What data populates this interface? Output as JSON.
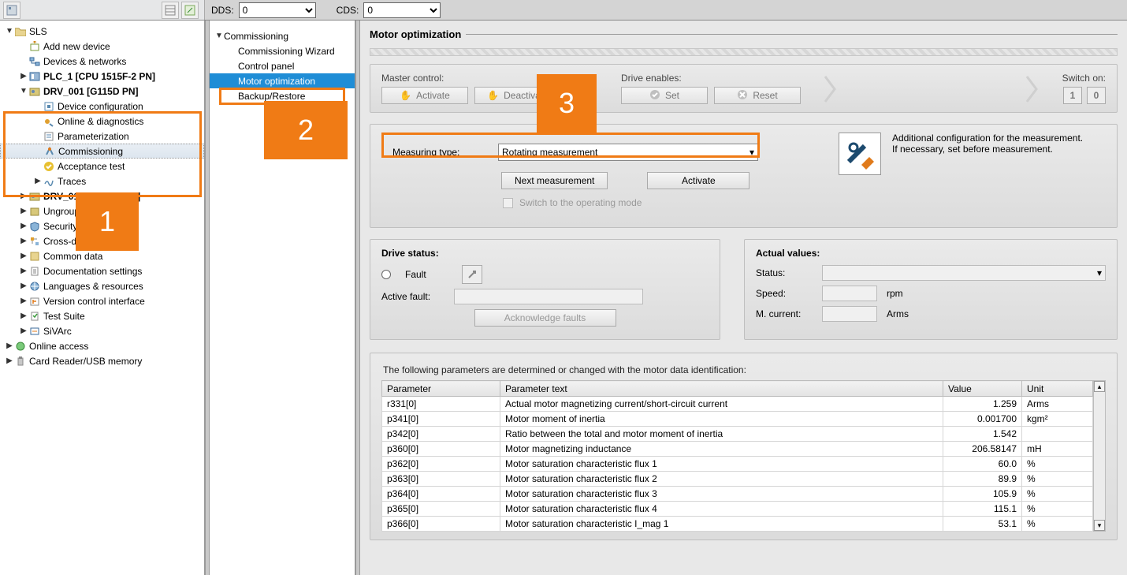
{
  "top": {
    "dds_label": "DDS:",
    "dds_value": "0",
    "cds_label": "CDS:",
    "cds_value": "0"
  },
  "tree": {
    "root": "SLS",
    "items": [
      {
        "label": "Add new device",
        "indent": 1,
        "icon": "add-device"
      },
      {
        "label": "Devices & networks",
        "indent": 1,
        "icon": "net"
      },
      {
        "label": "PLC_1 [CPU 1515F-2 PN]",
        "indent": 1,
        "icon": "plc",
        "exp": "▶",
        "bold": true
      },
      {
        "label": "DRV_001 [G115D PN]",
        "indent": 1,
        "icon": "drive",
        "exp": "▼",
        "bold": true,
        "boxed": true
      },
      {
        "label": "Device configuration",
        "indent": 2,
        "icon": "dev-cfg"
      },
      {
        "label": "Online & diagnostics",
        "indent": 2,
        "icon": "diag"
      },
      {
        "label": "Parameterization",
        "indent": 2,
        "icon": "param"
      },
      {
        "label": "Commissioning",
        "indent": 2,
        "icon": "commission",
        "selected": true
      },
      {
        "label": "Acceptance test",
        "indent": 2,
        "icon": "accept",
        "covered": true
      },
      {
        "label": "Traces",
        "indent": 2,
        "icon": "trace",
        "exp": "▶",
        "covered": true
      },
      {
        "label": "DRV_01          240D-2 PN-F]",
        "indent": 1,
        "icon": "drive",
        "exp": "▶",
        "bold": true,
        "covered": true
      },
      {
        "label": "Ungrouped devices",
        "indent": 1,
        "icon": "ungroup",
        "exp": "▶",
        "covered": true
      },
      {
        "label": "Security settings",
        "indent": 1,
        "icon": "shield",
        "exp": "▶"
      },
      {
        "label": "Cross-device functions",
        "indent": 1,
        "icon": "cross",
        "exp": "▶"
      },
      {
        "label": "Common data",
        "indent": 1,
        "icon": "common",
        "exp": "▶"
      },
      {
        "label": "Documentation settings",
        "indent": 1,
        "icon": "doc",
        "exp": "▶"
      },
      {
        "label": "Languages & resources",
        "indent": 1,
        "icon": "lang",
        "exp": "▶"
      },
      {
        "label": "Version control interface",
        "indent": 1,
        "icon": "vcs",
        "exp": "▶"
      },
      {
        "label": "Test Suite",
        "indent": 1,
        "icon": "test",
        "exp": "▶"
      },
      {
        "label": "SiVArc",
        "indent": 1,
        "icon": "siv",
        "exp": "▶"
      }
    ],
    "bottom": [
      {
        "label": "Online access",
        "icon": "online",
        "exp": "▶"
      },
      {
        "label": "Card Reader/USB memory",
        "icon": "usb",
        "exp": "▶"
      }
    ]
  },
  "sec_tree": {
    "root": "Commissioning",
    "items": [
      {
        "label": "Commissioning Wizard"
      },
      {
        "label": "Control panel"
      },
      {
        "label": "Motor optimization",
        "selected": true,
        "boxed": true
      },
      {
        "label": "Backup/Restore",
        "covered": true
      }
    ]
  },
  "content": {
    "title": "Motor optimization",
    "master": {
      "label": "Master control:",
      "activate": "Activate",
      "deactivate": "Deactivate"
    },
    "drive_enables": {
      "label": "Drive enables:",
      "set": "Set",
      "reset": "Reset"
    },
    "switch_on": {
      "label": "Switch on:",
      "b1": "1",
      "b0": "0"
    },
    "measuring": {
      "label": "Measuring type:",
      "value": "Rotating measurement",
      "next": "Next measurement",
      "activate": "Activate",
      "switch_op": "Switch to the operating mode"
    },
    "config_note_1": "Additional configuration for the measurement.",
    "config_note_2": "If necessary, set before measurement.",
    "drive_status": {
      "title": "Drive status:",
      "fault": "Fault",
      "active_fault": "Active fault:",
      "ack": "Acknowledge faults"
    },
    "actual": {
      "title": "Actual values:",
      "status": "Status:",
      "speed": "Speed:",
      "speed_unit": "rpm",
      "mcurrent": "M. current:",
      "mcurrent_unit": "Arms"
    },
    "table_caption": "The following parameters are determined or changed with the motor data identification:",
    "columns": {
      "p": "Parameter",
      "t": "Parameter text",
      "v": "Value",
      "u": "Unit"
    },
    "rows": [
      {
        "p": "r331[0]",
        "t": "Actual motor magnetizing current/short-circuit current",
        "v": "1.259",
        "u": "Arms"
      },
      {
        "p": "p341[0]",
        "t": "Motor moment of inertia",
        "v": "0.001700",
        "u": "kgm²"
      },
      {
        "p": "p342[0]",
        "t": "Ratio between the total and motor moment of inertia",
        "v": "1.542",
        "u": ""
      },
      {
        "p": "p360[0]",
        "t": "Motor magnetizing inductance",
        "v": "206.58147",
        "u": "mH"
      },
      {
        "p": "p362[0]",
        "t": "Motor saturation characteristic flux 1",
        "v": "60.0",
        "u": "%"
      },
      {
        "p": "p363[0]",
        "t": "Motor saturation characteristic flux 2",
        "v": "89.9",
        "u": "%"
      },
      {
        "p": "p364[0]",
        "t": "Motor saturation characteristic flux 3",
        "v": "105.9",
        "u": "%"
      },
      {
        "p": "p365[0]",
        "t": "Motor saturation characteristic flux 4",
        "v": "115.1",
        "u": "%"
      },
      {
        "p": "p366[0]",
        "t": "Motor saturation characteristic I_mag 1",
        "v": "53.1",
        "u": "%"
      }
    ]
  },
  "annotations": {
    "a1": "1",
    "a2": "2",
    "a3": "3"
  }
}
